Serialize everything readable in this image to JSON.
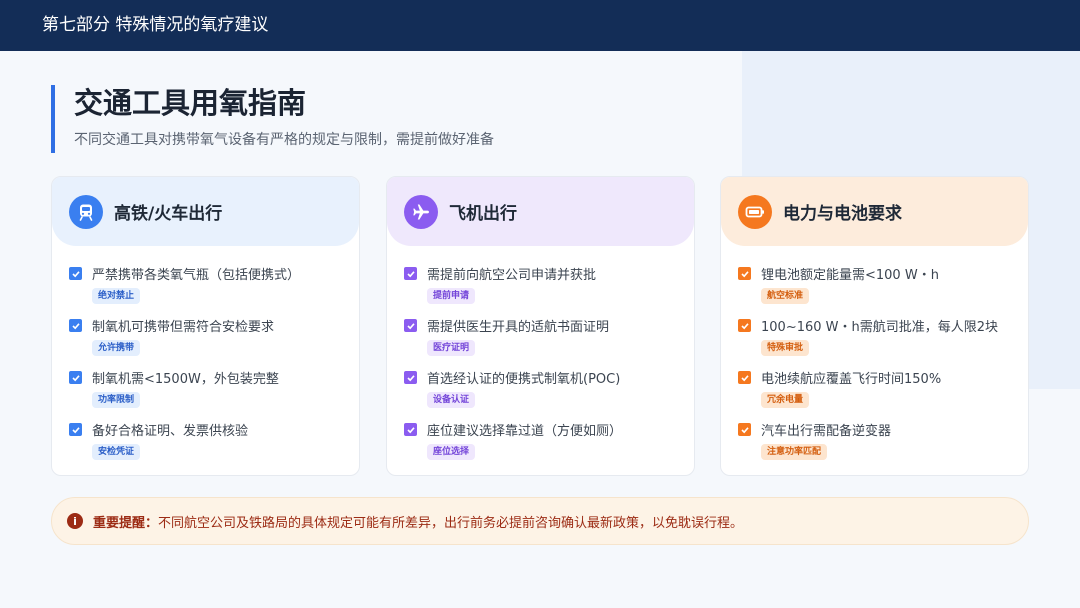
{
  "header": {
    "section_title": "第七部分 特殊情况的氧疗建议"
  },
  "page": {
    "title": "交通工具用氧指南",
    "subtitle": "不同交通工具对携带氧气设备有严格的规定与限制，需提前做好准备"
  },
  "colors": {
    "blue": "#3a7ff0",
    "purple": "#8b5cf0",
    "orange": "#f5781f",
    "navy": "#132d57",
    "warning": "#9c2b14"
  },
  "cards": [
    {
      "title": "高铁/火车出行",
      "icon": "train-icon",
      "items": [
        {
          "text": "严禁携带各类氧气瓶（包括便携式）",
          "tag": "绝对禁止"
        },
        {
          "text": "制氧机可携带但需符合安检要求",
          "tag": "允许携带"
        },
        {
          "text": "制氧机需<1500W，外包装完整",
          "tag": "功率限制"
        },
        {
          "text": "备好合格证明、发票供核验",
          "tag": "安检凭证"
        }
      ]
    },
    {
      "title": "飞机出行",
      "icon": "airplane-icon",
      "items": [
        {
          "text": "需提前向航空公司申请并获批",
          "tag": "提前申请"
        },
        {
          "text": "需提供医生开具的适航书面证明",
          "tag": "医疗证明"
        },
        {
          "text": "首选经认证的便携式制氧机(POC)",
          "tag": "设备认证"
        },
        {
          "text": "座位建议选择靠过道（方便如厕）",
          "tag": "座位选择"
        }
      ]
    },
    {
      "title": "电力与电池要求",
      "icon": "battery-icon",
      "items": [
        {
          "text": "锂电池额定能量需<100 W・h",
          "tag": "航空标准"
        },
        {
          "text": "100~160 W・h需航司批准，每人限2块",
          "tag": "特殊审批"
        },
        {
          "text": "电池续航应覆盖飞行时间150%",
          "tag": "冗余电量"
        },
        {
          "text": "汽车出行需配备逆变器",
          "tag": "注意功率匹配"
        }
      ]
    }
  ],
  "notice": {
    "icon": "info-icon",
    "label": "重要提醒：",
    "text": "不同航空公司及铁路局的具体规定可能有所差异，出行前务必提前咨询确认最新政策，以免耽误行程。"
  }
}
